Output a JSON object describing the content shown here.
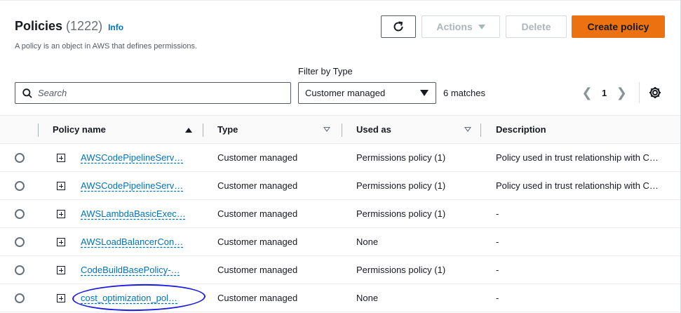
{
  "header": {
    "title": "Policies",
    "count": "(1222)",
    "info_link": "Info",
    "subtitle": "A policy is an object in AWS that defines permissions."
  },
  "toolbar": {
    "refresh_icon": "refresh-icon",
    "actions_label": "Actions",
    "delete_label": "Delete",
    "create_label": "Create policy",
    "create_color": "#ec7211"
  },
  "filters": {
    "filter_label": "Filter by Type",
    "search_placeholder": "Search",
    "search_value": "",
    "type_selected": "Customer managed",
    "matches": "6 matches"
  },
  "pagination": {
    "current_page": "1"
  },
  "table": {
    "columns": [
      "Policy name",
      "Type",
      "Used as",
      "Description"
    ],
    "rows": [
      {
        "name": "AWSCodePipelineServ…",
        "type": "Customer managed",
        "used_as": "Permissions policy (1)",
        "description": "Policy used in trust relationship with C…"
      },
      {
        "name": "AWSCodePipelineServ…",
        "type": "Customer managed",
        "used_as": "Permissions policy (1)",
        "description": "Policy used in trust relationship with C…"
      },
      {
        "name": "AWSLambdaBasicExec…",
        "type": "Customer managed",
        "used_as": "Permissions policy (1)",
        "description": "-"
      },
      {
        "name": "AWSLoadBalancerCon…",
        "type": "Customer managed",
        "used_as": "None",
        "description": "-"
      },
      {
        "name": "CodeBuildBasePolicy-…",
        "type": "Customer managed",
        "used_as": "Permissions policy (1)",
        "description": "-"
      },
      {
        "name": "cost_optimization_pol…",
        "type": "Customer managed",
        "used_as": "None",
        "description": "-"
      }
    ]
  },
  "colors": {
    "link": "#0073bb",
    "annotation": "#1a1ae0"
  }
}
